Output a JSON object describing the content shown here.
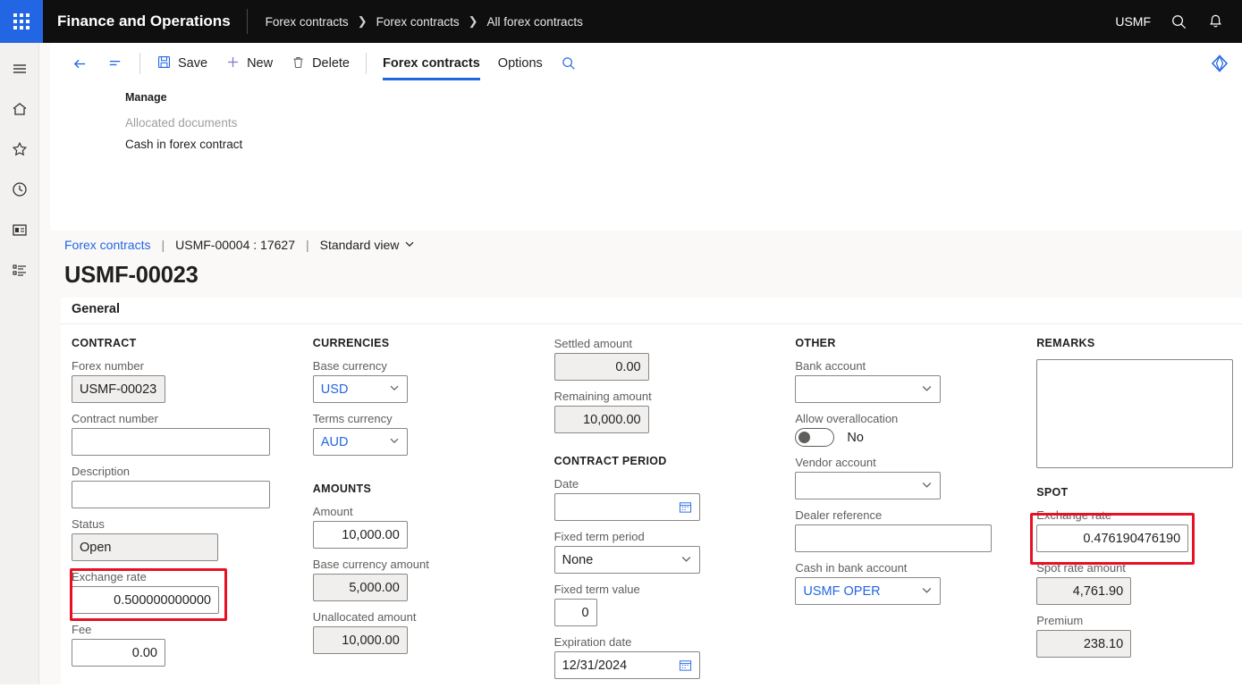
{
  "topnav": {
    "waffle_icon": "app-launcher-icon",
    "app_title": "Finance and Operations",
    "breadcrumb": [
      {
        "label": "Forex contracts"
      },
      {
        "label": "Forex contracts"
      },
      {
        "label": "All forex contracts"
      }
    ],
    "company": "USMF",
    "search_icon": "search-icon",
    "notification_icon": "bell-icon"
  },
  "leftrail": {
    "items": [
      {
        "icon": "hamburger-menu-icon"
      },
      {
        "icon": "home-icon"
      },
      {
        "icon": "star-favorites-icon"
      },
      {
        "icon": "clock-recent-icon"
      },
      {
        "icon": "workspaces-icon"
      },
      {
        "icon": "modules-list-icon"
      }
    ]
  },
  "toolbar": {
    "back_icon": "back-arrow-icon",
    "show_list_icon": "show-list-icon",
    "save_label": "Save",
    "save_icon": "save-disk-icon",
    "new_label": "New",
    "new_icon": "plus-icon",
    "delete_label": "Delete",
    "delete_icon": "trash-icon",
    "tabs": [
      {
        "label": "Forex contracts",
        "active": true
      },
      {
        "label": "Options",
        "active": false
      }
    ],
    "search_icon": "search-icon",
    "diamond_icon": "gem-diamond-icon"
  },
  "manage": {
    "title": "Manage",
    "links": [
      {
        "label": "Allocated documents",
        "disabled": true
      },
      {
        "label": "Cash in forex contract",
        "disabled": false
      }
    ]
  },
  "record": {
    "breadcrumb_link": "Forex contracts",
    "separator": "|",
    "reference": "USMF-00004 : 17627",
    "view_label": "Standard view",
    "view_chevron": "chevron-down-icon",
    "title": "USMF-00023"
  },
  "form": {
    "tab_general": "General",
    "contract": {
      "group": "CONTRACT",
      "forex_number_label": "Forex number",
      "forex_number_value": "USMF-00023",
      "contract_number_label": "Contract number",
      "contract_number_value": "",
      "description_label": "Description",
      "description_value": "",
      "status_label": "Status",
      "status_value": "Open",
      "exchange_rate_label": "Exchange rate",
      "exchange_rate_value": "0.500000000000",
      "fee_label": "Fee",
      "fee_value": "0.00"
    },
    "currencies": {
      "group": "CURRENCIES",
      "base_currency_label": "Base currency",
      "base_currency_value": "USD",
      "terms_currency_label": "Terms currency",
      "terms_currency_value": "AUD"
    },
    "amounts": {
      "group": "AMOUNTS",
      "amount_label": "Amount",
      "amount_value": "10,000.00",
      "base_currency_amount_label": "Base currency amount",
      "base_currency_amount_value": "5,000.00",
      "unallocated_amount_label": "Unallocated amount",
      "unallocated_amount_value": "10,000.00"
    },
    "settlement": {
      "settled_amount_label": "Settled amount",
      "settled_amount_value": "0.00",
      "remaining_amount_label": "Remaining amount",
      "remaining_amount_value": "10,000.00"
    },
    "contract_period": {
      "group": "CONTRACT PERIOD",
      "date_label": "Date",
      "date_value": "",
      "date_icon": "calendar-icon",
      "fixed_term_period_label": "Fixed term period",
      "fixed_term_period_value": "None",
      "fixed_term_value_label": "Fixed term value",
      "fixed_term_value_value": "0",
      "expiration_date_label": "Expiration date",
      "expiration_date_value": "12/31/2024",
      "expiration_date_icon": "calendar-icon"
    },
    "other": {
      "group": "OTHER",
      "bank_account_label": "Bank account",
      "bank_account_value": "",
      "allow_overallocation_label": "Allow overallocation",
      "allow_overallocation_value": "No",
      "vendor_account_label": "Vendor account",
      "vendor_account_value": "",
      "dealer_reference_label": "Dealer reference",
      "dealer_reference_value": "",
      "cash_in_bank_account_label": "Cash in bank account",
      "cash_in_bank_account_value": "USMF OPER"
    },
    "remarks": {
      "group": "REMARKS",
      "value": ""
    },
    "spot": {
      "group": "SPOT",
      "exchange_rate_label": "Exchange rate",
      "exchange_rate_value": "0.476190476190",
      "spot_rate_amount_label": "Spot rate amount",
      "spot_rate_amount_value": "4,761.90",
      "premium_label": "Premium",
      "premium_value": "238.10"
    }
  },
  "colors": {
    "accent": "#2266e3",
    "header_bg": "#0f0f0f",
    "highlight": "#e81123"
  }
}
